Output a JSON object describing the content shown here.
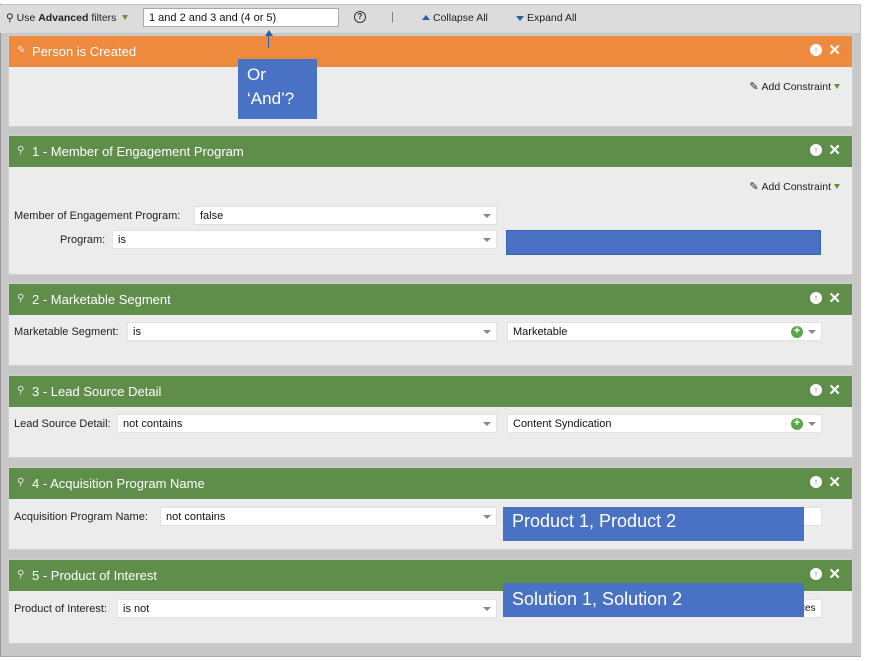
{
  "toolbar": {
    "advanced_prefix": "Use ",
    "advanced_bold": "Advanced",
    "advanced_suffix": " filters",
    "logic_value": "1 and 2 and 3 and (4 or 5)",
    "help_symbol": "?",
    "separator": "|",
    "collapse_label": "Collapse All",
    "expand_label": "Expand All"
  },
  "trigger": {
    "title": "Person is Created",
    "add_constraint": "Add Constraint",
    "color": "#ee8a3d"
  },
  "callout": {
    "line1": "Or",
    "line2": "‘And’?"
  },
  "filters": [
    {
      "title": "1 - Member of Engagement Program",
      "add_constraint": "Add Constraint",
      "rows": [
        {
          "label": "Member of Engagement Program:",
          "operator": "false"
        },
        {
          "label": "Program:",
          "operator": "is"
        }
      ]
    },
    {
      "title": "2 - Marketable Segment",
      "rows": [
        {
          "label": "Marketable Segment:",
          "operator": "is",
          "value": "Marketable"
        }
      ]
    },
    {
      "title": "3 - Lead Source Detail",
      "rows": [
        {
          "label": "Lead Source Detail:",
          "operator": "not contains",
          "value": "Content Syndication"
        }
      ]
    },
    {
      "title": "4 - Acquisition Program Name",
      "rows": [
        {
          "label": "Acquisition Program Name:",
          "operator": "not contains",
          "overlay": "Product 1, Product 2"
        }
      ]
    },
    {
      "title": "5 - Product of Interest",
      "rows": [
        {
          "label": "Product of Interest:",
          "operator": "is not",
          "overlay": "Solution 1, Solution 2",
          "value_tail": "ces"
        }
      ]
    }
  ],
  "colors": {
    "filter_header": "#5f8d4a",
    "overlay_blue": "#4a72c4"
  },
  "icons": {
    "move_up": "arrow-up-circle-icon",
    "remove": "close-icon",
    "add_value": "plus-circle-icon",
    "filter": "filter-funnel-icon"
  }
}
